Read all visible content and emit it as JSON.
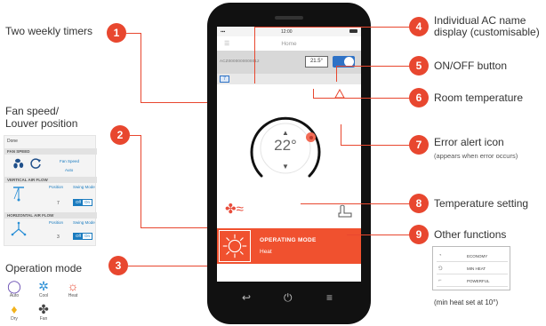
{
  "callouts": [
    {
      "number": "1",
      "label": "Two weekly timers"
    },
    {
      "number": "2",
      "label": "Fan speed/\nLouver position"
    },
    {
      "number": "3",
      "label": "Operation mode"
    },
    {
      "number": "4",
      "label": "Individual AC name\ndisplay (customisable)"
    },
    {
      "number": "5",
      "label": "ON/OFF button"
    },
    {
      "number": "6",
      "label": "Room temperature"
    },
    {
      "number": "7",
      "label": "Error alert icon",
      "sublabel": "(appears when error occurs)"
    },
    {
      "number": "8",
      "label": "Temperature setting"
    },
    {
      "number": "9",
      "label": "Other functions",
      "sublabel": "(min heat set at 10°)"
    }
  ],
  "fan_panel": {
    "done": "Done",
    "fan_speed_section": "FAN SPEED",
    "fan_speed_label": "Fan Speed",
    "fan_speed_value": "Auto",
    "vertical_section": "VERTICAL AIR FLOW",
    "horizontal_section": "HORIZONTAL AIR FLOW",
    "position_label": "Position",
    "swing_label": "Swing Mode",
    "vertical_position": "7",
    "horizontal_position": "3",
    "toggle_off": "Off",
    "toggle_on": "On"
  },
  "modes": [
    {
      "label": "Auto",
      "icon": "auto-mode-icon",
      "color": "#6a4fb3"
    },
    {
      "label": "Cool",
      "icon": "cool-mode-icon",
      "color": "#2a8fd6"
    },
    {
      "label": "Heat",
      "icon": "heat-mode-icon",
      "color": "#e8472f"
    },
    {
      "label": "Dry",
      "icon": "dry-mode-icon",
      "color": "#f2b21c"
    },
    {
      "label": "Fan",
      "icon": "fan-mode-icon",
      "color": "#444444"
    }
  ],
  "phone": {
    "status_time": "12:00",
    "header_title": "Home",
    "ac_name": "ACZ0000000000012",
    "room_temperature": "21.5°",
    "timer_badge": "7",
    "set_temperature": "22°",
    "operating_mode_title": "OPERATING MODE",
    "operating_mode_value": "Heat"
  },
  "other_functions": [
    "ECONOMY",
    "MIN HEAT",
    "POWERFUL"
  ],
  "colors": {
    "accent": "#e8472f",
    "toggle_blue": "#2e72c6",
    "mode_bar": "#f0512f"
  }
}
